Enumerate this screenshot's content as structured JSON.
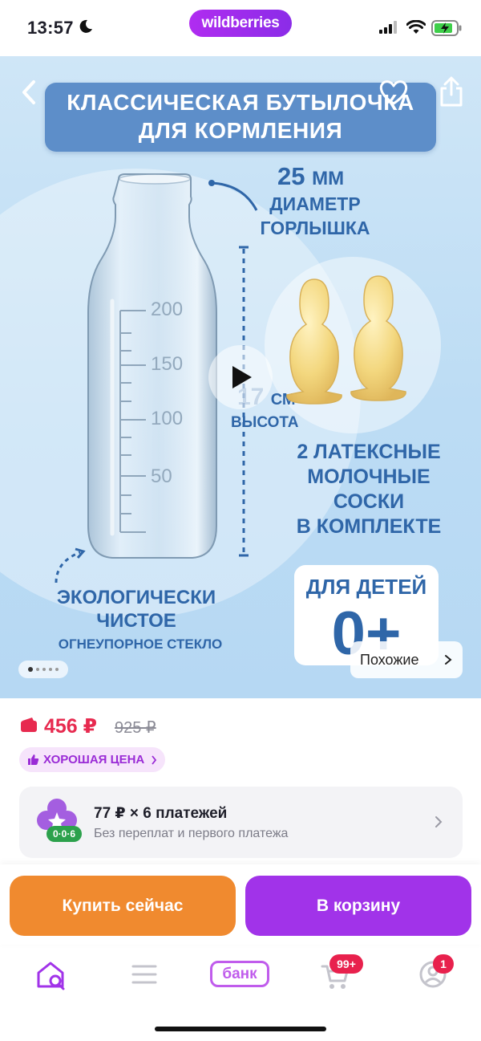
{
  "status_bar": {
    "time": "13:57",
    "app_logo": "wildberries"
  },
  "product_image": {
    "title_line1": "КЛАССИЧЕСКАЯ БУТЫЛОЧКА",
    "title_line2": "ДЛЯ КОРМЛЕНИЯ",
    "neck_size": "25",
    "neck_unit": "ММ",
    "neck_label_line1": "ДИАМЕТР",
    "neck_label_line2": "ГОРЛЫШКА",
    "height_value": "17",
    "height_unit": "СМ",
    "height_label": "ВЫСОТА",
    "scale_marks": [
      "200",
      "150",
      "100",
      "50"
    ],
    "teats_line1": "2 ЛАТЕКСНЫЕ",
    "teats_line2": "МОЛОЧНЫЕ",
    "teats_line3": "СОСКИ",
    "teats_line4": "В КОМПЛЕКТЕ",
    "eco_line1": "ЭКОЛОГИЧЕСКИ",
    "eco_line2": "ЧИСТОЕ",
    "eco_line3": "ОГНЕУПОРНОЕ СТЕКЛО",
    "age_label": "ДЛЯ ДЕТЕЙ",
    "age_value": "0+",
    "similar_label": "Похожие",
    "gallery_total": 5,
    "gallery_index": 1
  },
  "pricing": {
    "price": "456 ₽",
    "old_price": "925 ₽",
    "good_price_label": "ХОРОШАЯ ЦЕНА",
    "installment_title": "77 ₽ × 6 платежей",
    "installment_subtitle": "Без переплат и первого платежа",
    "installment_badge": "0·0·6"
  },
  "actions": {
    "buy_now": "Купить сейчас",
    "add_to_cart": "В корзину"
  },
  "tab_bar": {
    "bank_label": "банк",
    "cart_count": "99+",
    "profile_count": "1"
  },
  "colors": {
    "brand_purple": "#a133e9",
    "buy_orange": "#f08a2f",
    "price_red": "#e72a4f",
    "banner_blue": "#5d8ec9",
    "text_blue": "#2f66a8"
  }
}
